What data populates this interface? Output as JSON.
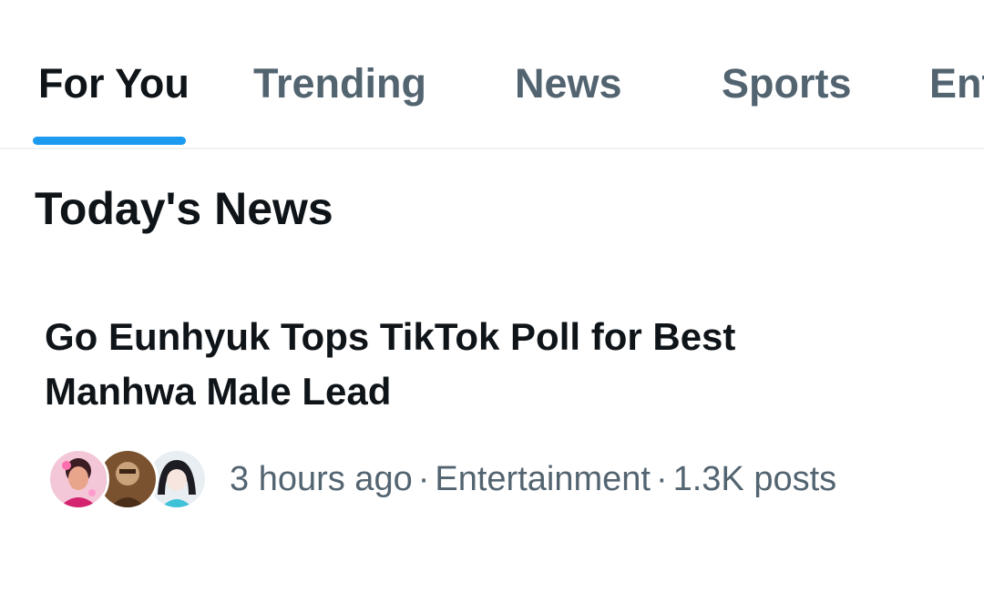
{
  "tabs": [
    {
      "label": "For You",
      "active": true
    },
    {
      "label": "Trending",
      "active": false
    },
    {
      "label": "News",
      "active": false
    },
    {
      "label": "Sports",
      "active": false
    },
    {
      "label": "Entertainment",
      "active": false
    }
  ],
  "section": {
    "title": "Today's News"
  },
  "news": [
    {
      "headline": "Go Eunhyuk Tops TikTok Poll for Best Manhwa Male Lead",
      "time": "3 hours ago",
      "category": "Entertainment",
      "posts": "1.3K posts",
      "separator": "·",
      "avatars": [
        "avatar-pink-portrait",
        "avatar-brown-figure",
        "avatar-anime-character"
      ]
    }
  ],
  "colors": {
    "accent": "#1d9bf0",
    "primary_text": "#0f1419",
    "secondary_text": "#536471",
    "divider": "#eff3f4"
  }
}
